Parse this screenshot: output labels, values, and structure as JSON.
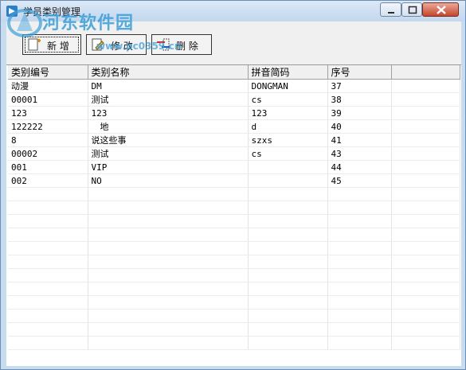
{
  "window": {
    "title": "学员类别管理",
    "watermark": "河东软件园",
    "watermark_url": "www.pc0359.cn"
  },
  "toolbar": {
    "add_label": "新 增",
    "edit_label": "修 改",
    "delete_label": "删 除"
  },
  "table": {
    "headers": [
      "类别编号",
      "类别名称",
      "拼音简码",
      "序号"
    ],
    "rows": [
      [
        "动漫",
        "DM",
        "DONGMAN",
        "37"
      ],
      [
        "00001",
        "测试",
        "cs",
        "38"
      ],
      [
        "123",
        "123",
        "123",
        "39"
      ],
      [
        "122222",
        "　地",
        "d",
        "40"
      ],
      [
        "8",
        "说这些事",
        "szxs",
        "41"
      ],
      [
        "00002",
        "测试",
        "cs",
        "43"
      ],
      [
        "001",
        "VIP",
        "",
        "44"
      ],
      [
        "002",
        "NO",
        "",
        "45"
      ]
    ]
  },
  "colors": {
    "title_bar": "#c8dcf0",
    "close_button": "#c7452c",
    "watermark": "#3a9ed8"
  },
  "icons": [
    "app-icon",
    "add-icon",
    "edit-icon",
    "delete-icon",
    "minimize-icon",
    "maximize-icon",
    "close-icon"
  ]
}
